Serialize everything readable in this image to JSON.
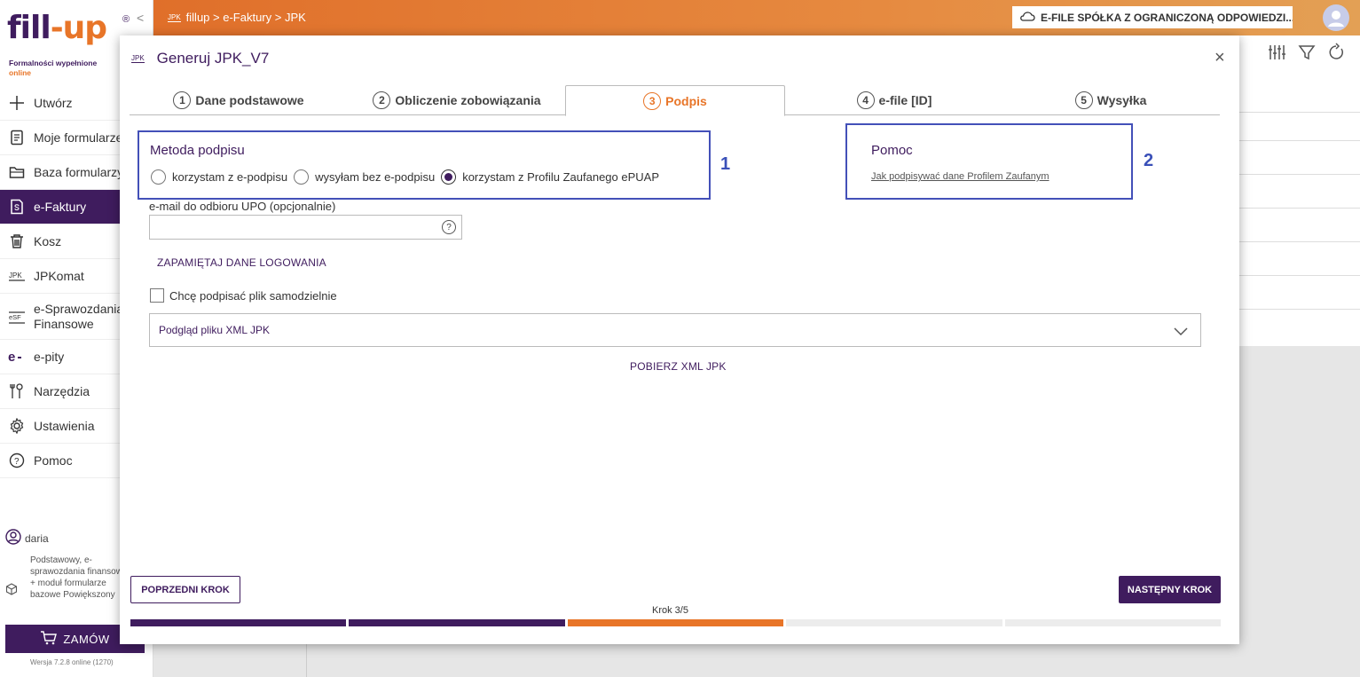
{
  "sidebar": {
    "logo_fill": "fill",
    "logo_dash": "-",
    "logo_up": "up",
    "logo_reg": "®",
    "tagline_1": "Formalności wypełnione",
    "tagline_2": "online",
    "collapse": "<",
    "items": [
      {
        "label": "Utwórz",
        "icon": "plus-icon"
      },
      {
        "label": "Moje formularze",
        "icon": "document-icon"
      },
      {
        "label": "Baza formularzy",
        "icon": "folder-icon"
      },
      {
        "label": "e-Faktury",
        "icon": "invoice-icon"
      },
      {
        "label": "Kosz",
        "icon": "trash-icon"
      },
      {
        "label": "JPKomat",
        "icon": "jpk-icon"
      },
      {
        "label_1": "e-Sprawozdania",
        "label_2": "Finansowe",
        "icon": "esf-icon"
      },
      {
        "label": "e-pity",
        "icon": "epit-icon"
      },
      {
        "label": "Narzędzia",
        "icon": "tools-icon"
      },
      {
        "label": "Ustawienia",
        "icon": "gear-icon"
      },
      {
        "label": "Pomoc",
        "icon": "help-icon"
      }
    ],
    "user_name": "daria",
    "user_plan": "Podstawowy, e-sprawozdania finansowe + moduł formularze bazowe Powiększony",
    "order_label": "ZAMÓW",
    "version": "Wersja 7.2.8 online (1270)"
  },
  "topbar": {
    "jpk_tag": "JPK",
    "breadcrumb": "fillup > e-Faktury > JPK",
    "company": "E-FILE SPÓŁKA Z OGRANICZONĄ ODPOWIEDZI..."
  },
  "modal": {
    "jpk_tag": "JPK",
    "title": "Generuj JPK_V7",
    "close": "×",
    "tabs": [
      {
        "num": "1",
        "label": "Dane podstawowe"
      },
      {
        "num": "2",
        "label": "Obliczenie zobowiązania"
      },
      {
        "num": "3",
        "label": "Podpis"
      },
      {
        "num": "4",
        "label": "e-file [ID]"
      },
      {
        "num": "5",
        "label": "Wysyłka"
      }
    ],
    "active_tab": 3,
    "signature": {
      "title": "Metoda podpisu",
      "options": [
        "korzystam z e-podpisu",
        "wysyłam bez e-podpisu",
        "korzystam z Profilu Zaufanego ePUAP"
      ],
      "selected": "korzystam z Profilu Zaufanego ePUAP",
      "marker": "1"
    },
    "help": {
      "title": "Pomoc",
      "link": "Jak podpisywać dane Profilem Zaufanym",
      "marker": "2"
    },
    "email_label": "e-mail do odbioru UPO (opcjonalnie)",
    "email_value": "",
    "email_help": "?",
    "remember_label": "ZAPAMIĘTAJ DANE LOGOWANIA",
    "self_sign_label": "Chcę podpisać plik samodzielnie",
    "xml_preview_label": "Podgląd pliku XML JPK",
    "download_label": "POBIERZ XML JPK",
    "prev_label": "POPRZEDNI KROK",
    "next_label": "NASTĘPNY KROK",
    "step_label": "Krok 3/5",
    "step_current": 3,
    "step_total": 5
  },
  "colors": {
    "brand_purple": "#3f1c5e",
    "brand_orange": "#e87528",
    "annotation_blue": "#4350b8"
  }
}
